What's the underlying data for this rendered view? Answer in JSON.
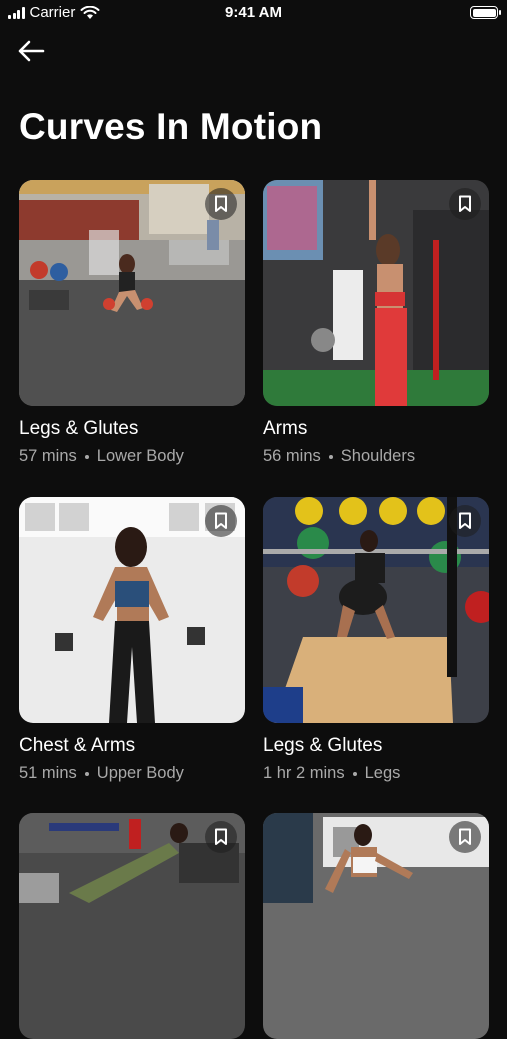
{
  "status_bar": {
    "carrier": "Carrier",
    "time": "9:41 AM"
  },
  "page": {
    "title": "Curves In Motion"
  },
  "workouts": [
    {
      "title": "Legs & Glutes",
      "duration": "57 mins",
      "category": "Lower Body"
    },
    {
      "title": "Arms",
      "duration": "56 mins",
      "category": "Shoulders"
    },
    {
      "title": "Chest & Arms",
      "duration": "51 mins",
      "category": "Upper Body"
    },
    {
      "title": "Legs & Glutes",
      "duration": "1 hr 2 mins",
      "category": "Legs"
    },
    {
      "title": "",
      "duration": "",
      "category": ""
    },
    {
      "title": "",
      "duration": "",
      "category": ""
    }
  ],
  "icons": {
    "back": "arrow-left-icon",
    "bookmark": "bookmark-icon"
  }
}
